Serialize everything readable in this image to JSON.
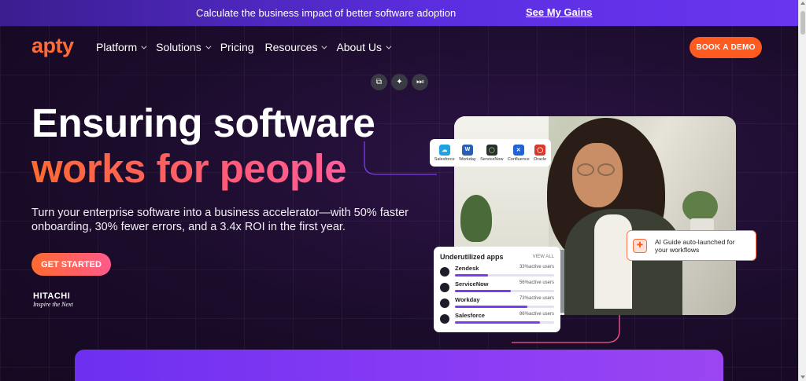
{
  "banner": {
    "text": "Calculate the business impact of better software adoption",
    "link": "See My Gains"
  },
  "header": {
    "logo": "apty",
    "nav": [
      "Platform",
      "Solutions",
      "Pricing",
      "Resources",
      "About Us"
    ],
    "cta": "BOOK A DEMO"
  },
  "hero": {
    "title_line1": "Ensuring software",
    "title_line2": "works for people",
    "subtitle": "Turn your enterprise software into a business accelerator—with 50% faster onboarding, 30% fewer errors, and a 3.4x ROI in the first year.",
    "cta": "GET STARTED",
    "client_name": "HITACHI",
    "client_tagline": "Inspire the Next"
  },
  "integrations": [
    {
      "name": "Salesforce",
      "color": "#1ea2e0",
      "glyph": "☁"
    },
    {
      "name": "Workday",
      "color": "#2b5fb4",
      "glyph": "W"
    },
    {
      "name": "ServiceNow",
      "color": "#2b2f2f",
      "glyph": "◯"
    },
    {
      "name": "Confluence",
      "color": "#1f63d6",
      "glyph": "✕"
    },
    {
      "name": "Oracle",
      "color": "#d9382a",
      "glyph": "◯"
    }
  ],
  "ai_card": {
    "text": "AI Guide auto-launched for your workflows",
    "icon": "chip-icon"
  },
  "apps_card": {
    "title": "Underutilized apps",
    "view_all": "VIEW ALL",
    "apps": [
      {
        "name": "Zendesk",
        "pct_label": "33%active users",
        "pct": 0.33
      },
      {
        "name": "ServiceNow",
        "pct_label": "56%active users",
        "pct": 0.56
      },
      {
        "name": "Workday",
        "pct_label": "73%active users",
        "pct": 0.73
      },
      {
        "name": "Salesforce",
        "pct_label": "86%active users",
        "pct": 0.86
      }
    ]
  },
  "tools": [
    "copy-icon",
    "sparkle-icon",
    "skip-icon"
  ],
  "colors": {
    "accent": "#ff5a1f",
    "purple": "#6d2ff0"
  }
}
